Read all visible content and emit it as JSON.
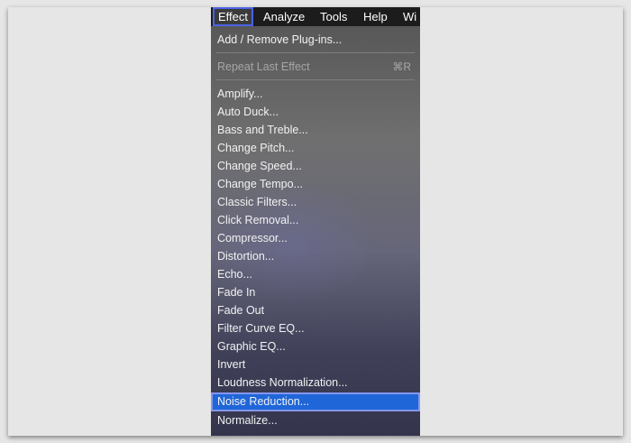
{
  "menubar": {
    "items": [
      "Effect",
      "Analyze",
      "Tools",
      "Help",
      "Wi"
    ],
    "active": "Effect"
  },
  "menu": {
    "add_remove": "Add / Remove Plug-ins...",
    "repeat_last": "Repeat Last Effect",
    "repeat_shortcut": "⌘R",
    "items": [
      "Amplify...",
      "Auto Duck...",
      "Bass and Treble...",
      "Change Pitch...",
      "Change Speed...",
      "Change Tempo...",
      "Classic Filters...",
      "Click Removal...",
      "Compressor...",
      "Distortion...",
      "Echo...",
      "Fade In",
      "Fade Out",
      "Filter Curve EQ...",
      "Graphic EQ...",
      "Invert",
      "Loudness Normalization...",
      "Noise Reduction...",
      "Normalize..."
    ],
    "highlighted": "Noise Reduction..."
  },
  "colors": {
    "highlight": "#1f66d8",
    "annotation_outline": "#4b63e6"
  }
}
